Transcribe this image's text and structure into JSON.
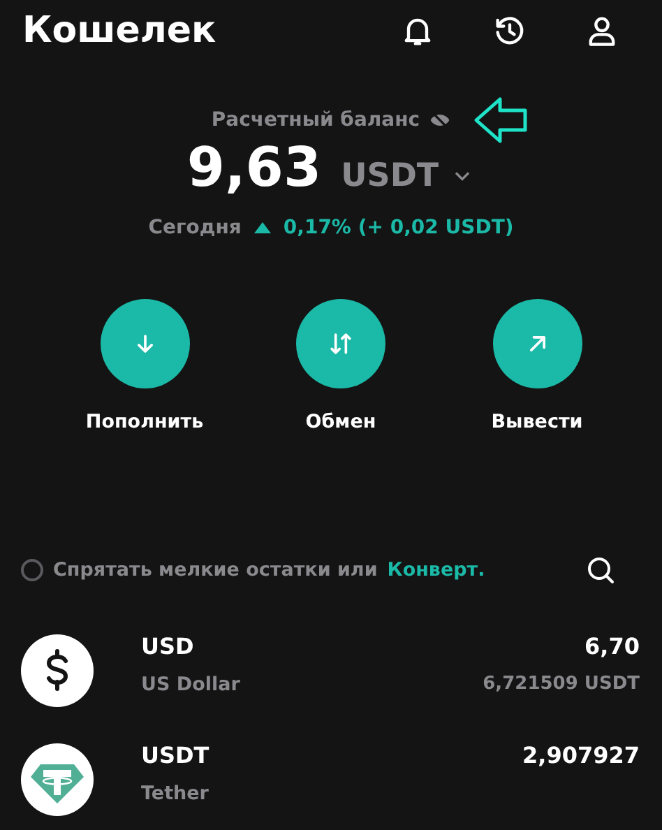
{
  "header": {
    "title": "Кошелек"
  },
  "balance": {
    "label": "Расчетный баланс",
    "amount": "9,63",
    "currency": "USDT",
    "period": "Сегодня",
    "change": "0,17% (+ 0,02 USDT)",
    "rising": true
  },
  "actions": [
    {
      "kind": "deposit",
      "label": "Пополнить"
    },
    {
      "kind": "exchange",
      "label": "Обмен"
    },
    {
      "kind": "withdraw",
      "label": "Вывести"
    }
  ],
  "filter": {
    "checked": false,
    "text": "Спрятать мелкие остатки или",
    "link": "Конверт."
  },
  "assets": [
    {
      "kind": "dollar",
      "symbol": "USD",
      "name": "US Dollar",
      "amount": "6,70",
      "value": "6,721509 USDT"
    },
    {
      "kind": "tether",
      "symbol": "USDT",
      "name": "Tether",
      "amount": "2,907927"
    }
  ]
}
